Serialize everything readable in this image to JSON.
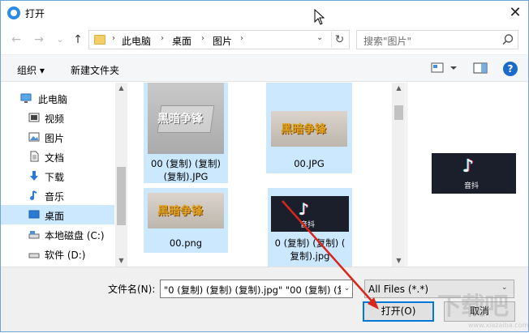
{
  "window": {
    "title": "打开",
    "close_glyph": "✕"
  },
  "nav": {
    "back_glyph": "←",
    "forward_glyph": "→",
    "recent_glyph": "⌄",
    "up_glyph": "↑",
    "breadcrumb": [
      "此电脑",
      "桌面",
      "图片"
    ],
    "search_placeholder": "搜索\"图片\""
  },
  "toolbar": {
    "organize": "组织 ▾",
    "new_folder": "新建文件夹",
    "help_glyph": "?"
  },
  "sidebar": {
    "items": [
      {
        "label": "此电脑",
        "icon": "computer-icon",
        "selected": false
      },
      {
        "label": "视频",
        "icon": "video-icon",
        "selected": false
      },
      {
        "label": "图片",
        "icon": "pictures-icon",
        "selected": false
      },
      {
        "label": "文档",
        "icon": "documents-icon",
        "selected": false
      },
      {
        "label": "下载",
        "icon": "download-icon",
        "selected": false
      },
      {
        "label": "音乐",
        "icon": "music-icon",
        "selected": false
      },
      {
        "label": "桌面",
        "icon": "desktop-icon",
        "selected": true
      },
      {
        "label": "本地磁盘 (C:)",
        "icon": "drive-icon",
        "selected": false
      },
      {
        "label": "软件 (D:)",
        "icon": "drive-icon",
        "selected": false
      }
    ]
  },
  "files": [
    {
      "name_line1": "00 (复制) (复制)",
      "name_line2": "(复制).JPG",
      "selected": true,
      "thumb_text": "黑暗争锋"
    },
    {
      "name_line1": "00.JPG",
      "name_line2": "",
      "selected": true,
      "thumb_text": "黑暗争锋"
    },
    {
      "name_line1": "00.png",
      "name_line2": "",
      "selected": true,
      "thumb_text": "黑暗争锋"
    },
    {
      "name_line1": "0 (复制) (复制) (",
      "name_line2": "复制).jpg",
      "selected": true,
      "thumb_text": "音抖"
    }
  ],
  "preview": {
    "thumb_text": "音抖"
  },
  "bottom": {
    "filename_label": "文件名(N):",
    "filename_value": "\"0 (复制) (复制) (复制).jpg\" \"00 (复制) (复",
    "filetype_value": "All Files (*.*)",
    "open_button": "打开(O)",
    "cancel_button": "取消"
  },
  "watermark": {
    "text": "下载吧",
    "sub": "www.xiazaiba.com"
  },
  "colors": {
    "selection": "#cce8ff",
    "accent": "#0078d7",
    "annotation_arrow": "#d9261c"
  }
}
